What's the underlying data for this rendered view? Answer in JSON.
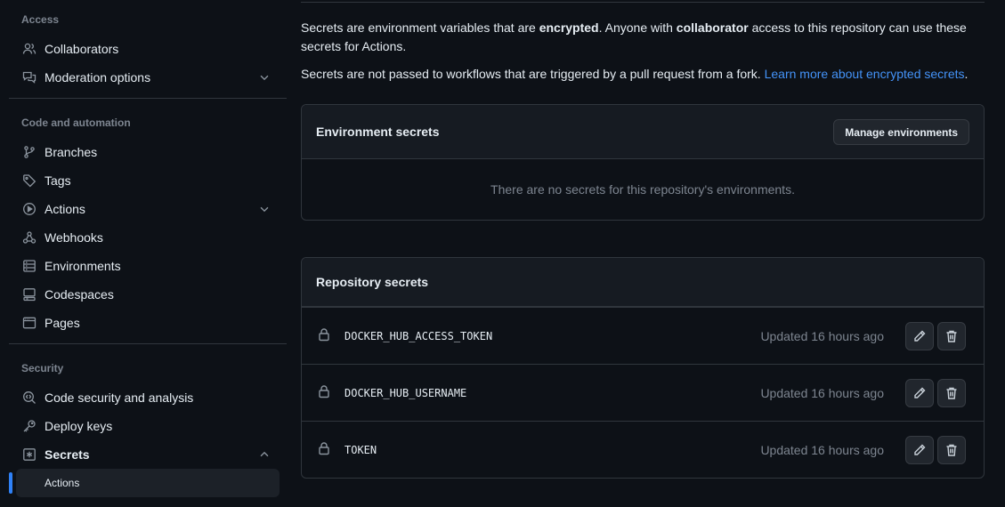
{
  "sidebar": {
    "access_title": "Access",
    "code_title": "Code and automation",
    "security_title": "Security",
    "items": {
      "collaborators": "Collaborators",
      "moderation": "Moderation options",
      "branches": "Branches",
      "tags": "Tags",
      "actions": "Actions",
      "webhooks": "Webhooks",
      "environments": "Environments",
      "codespaces": "Codespaces",
      "pages": "Pages",
      "code_security": "Code security and analysis",
      "deploy_keys": "Deploy keys",
      "secrets": "Secrets",
      "secrets_actions": "Actions"
    }
  },
  "main": {
    "intro": {
      "p1_a": "Secrets are environment variables that are ",
      "p1_b": "encrypted",
      "p1_c": ". Anyone with ",
      "p1_d": "collaborator",
      "p1_e": " access to this repository can use these secrets for Actions.",
      "p2_a": "Secrets are not passed to workflows that are triggered by a pull request from a fork. ",
      "p2_link": "Learn more about encrypted secrets",
      "p2_end": "."
    },
    "environment_secrets": {
      "title": "Environment secrets",
      "button": "Manage environments",
      "empty": "There are no secrets for this repository's environments."
    },
    "repository_secrets": {
      "title": "Repository secrets",
      "rows": [
        {
          "name": "DOCKER_HUB_ACCESS_TOKEN",
          "updated": "Updated 16 hours ago"
        },
        {
          "name": "DOCKER_HUB_USERNAME",
          "updated": "Updated 16 hours ago"
        },
        {
          "name": "TOKEN",
          "updated": "Updated 16 hours ago"
        }
      ]
    }
  },
  "colors": {
    "background": "#0d1117",
    "accent": "#2f81f7",
    "link": "#4493f8",
    "border": "#30363d",
    "muted": "#7d8590"
  },
  "icons": {
    "collaborators": "people-icon",
    "moderation": "comment-discussion-icon",
    "branches": "git-branch-icon",
    "tags": "tag-icon",
    "actions": "play-icon",
    "webhooks": "webhook-icon",
    "environments": "server-icon",
    "codespaces": "codespaces-icon",
    "pages": "browser-icon",
    "code_security": "codescan-icon",
    "deploy_keys": "key-icon",
    "secrets": "asterisk-icon",
    "secret_row": "lock-icon",
    "edit": "pencil-icon",
    "delete": "trash-icon"
  }
}
